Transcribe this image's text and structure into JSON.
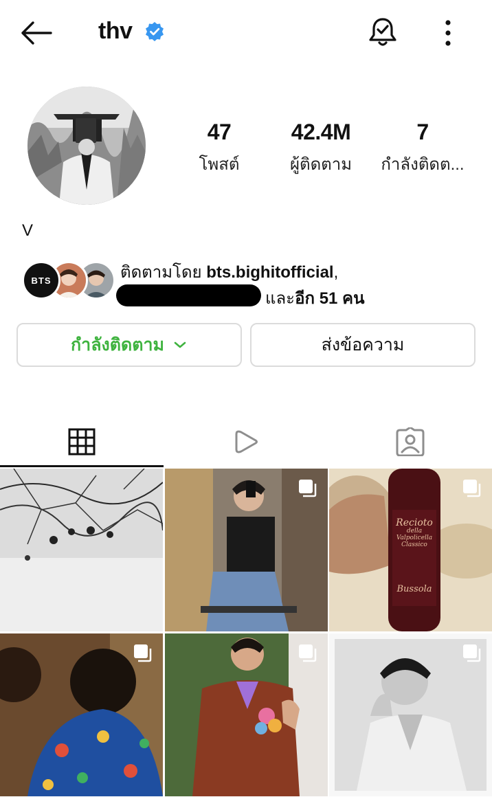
{
  "header": {
    "username": "thv"
  },
  "profile": {
    "stats": [
      {
        "value": "47",
        "label": "โพสต์"
      },
      {
        "value": "42.4M",
        "label": "ผู้ติดตาม"
      },
      {
        "value": "7",
        "label": "กำลังติดต..."
      }
    ],
    "display_name": "V",
    "mutual_badge_text": "BTS",
    "followed_by_prefix": "ติดตามโดย ",
    "followed_by_account": "bts.bighitofficial",
    "followed_by_suffix": ",",
    "and_more_prefix": "และ",
    "and_more_count": "อีก 51 คน"
  },
  "actions": {
    "following_label": "กำลังติดตาม",
    "message_label": "ส่งข้อความ"
  },
  "colors": {
    "accent_green": "#3fb33f",
    "verified_blue": "#3897f0"
  },
  "tabs": [
    {
      "icon": "grid-icon",
      "active": true
    },
    {
      "icon": "reels-play-icon",
      "active": false
    },
    {
      "icon": "tagged-person-icon",
      "active": false
    }
  ],
  "posts": [
    {
      "subject": "black and white branches photo",
      "multi": false
    },
    {
      "subject": "mirror selfie man sitting",
      "multi": true
    },
    {
      "subject": "wine bottle",
      "multi": true,
      "label_lines": [
        "Recioto",
        "della",
        "Valpolicella",
        "Classico",
        "Bussola"
      ]
    },
    {
      "subject": "man in floral shirt",
      "multi": true
    },
    {
      "subject": "man in brown suit",
      "multi": true
    },
    {
      "subject": "black and white portrait",
      "multi": true
    }
  ]
}
